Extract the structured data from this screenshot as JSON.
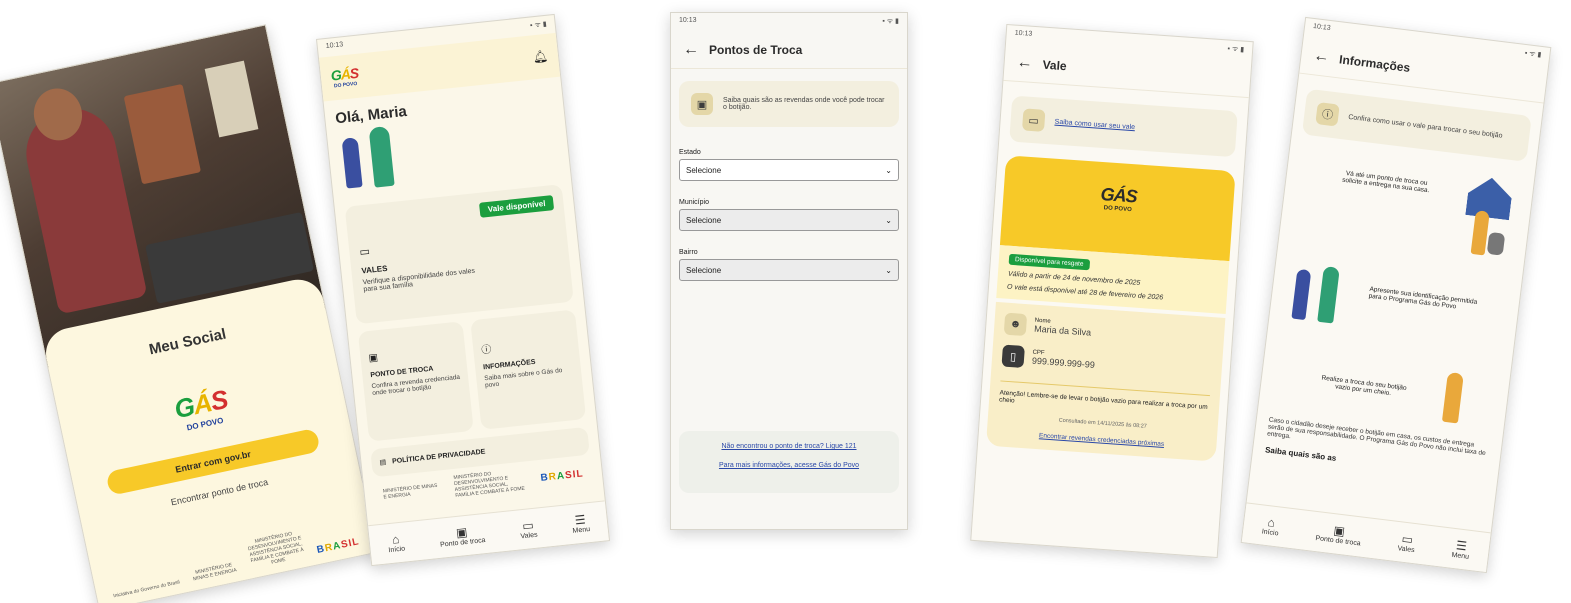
{
  "screen1": {
    "title": "Meu Social",
    "logo": {
      "g": "G",
      "a": "Á",
      "s": "S",
      "sub": "DO POVO"
    },
    "login_button": "Entrar com gov.br",
    "find_link": "Encontrar ponto de troca",
    "footer_initiative": "Iniciativa do Governo do Brasil",
    "ministry_1": "MINISTÉRIO DE MINAS E ENERGIA",
    "ministry_2": "MINISTÉRIO DO DESENVOLVIMENTO E ASSISTÊNCIA SOCIAL, FAMÍLIA E COMBATE À FOME",
    "brasil": [
      "B",
      "R",
      "A",
      "SIL"
    ]
  },
  "screen2": {
    "status_time": "10:13",
    "greeting": "Olá, Maria",
    "vales_badge": "Vale disponível",
    "vales_title": "VALES",
    "vales_desc": "Verifique a disponibilidade dos vales para sua família",
    "ponto_title": "PONTO DE TROCA",
    "ponto_desc": "Confira a revenda credenciada onde trocar o botijão",
    "info_title": "INFORMAÇÕES",
    "info_desc": "Saiba mais sobre o Gás do povo",
    "privacy": "POLÍTICA DE PRIVACIDADE",
    "ministry_1": "MINISTÉRIO DE MINAS E ENERGIA",
    "ministry_2": "MINISTÉRIO DO DESENVOLVIMENTO E ASSISTÊNCIA SOCIAL, FAMÍLIA E COMBATE À FOME",
    "nav": [
      "Início",
      "Ponto de troca",
      "Vales",
      "Menu"
    ]
  },
  "screen3": {
    "status_time": "10:13",
    "title": "Pontos de Troca",
    "info": "Saiba quais são as revendas onde você pode trocar o botijão.",
    "estado_label": "Estado",
    "municipio_label": "Município",
    "bairro_label": "Bairro",
    "select_placeholder": "Selecione",
    "help_link": "Não encontrou o ponto de troca? Ligue 121",
    "more_link": "Para mais informações, acesse Gás do Povo"
  },
  "screen4": {
    "status_time": "10:13",
    "title": "Vale",
    "how_link": "Saiba como usar seu vale",
    "status_badge": "Disponível para resgate",
    "valid_from": "Válido a partir de 24 de novembro de 2025",
    "valid_until": "O vale está disponível até 28 de fevereiro de 2026",
    "name_label": "Nome",
    "name_value": "Maria da Silva",
    "cpf_label": "CPF",
    "cpf_value": "999.999.999-99",
    "attention": "Atenção! Lembre-se de levar o botijão vazio para realizar a troca por um cheio",
    "consulted": "Consultado em 14/11/2025 às 08:27",
    "nearby_link": "Encontrar revendas credenciadas próximas"
  },
  "screen5": {
    "status_time": "10:13",
    "title": "Informações",
    "info": "Confira como usar o vale para trocar o seu botijão",
    "step1": "Vá até um ponto de troca ou solicite a entrega na sua casa.",
    "step2": "Apresente sua identificação permitida para o Programa Gás do Povo",
    "step3": "Realize a troca do seu botijão vazio por um cheio.",
    "note": "Caso o cidadão deseje receber o botijão em casa, os custos de entrega serão de sua responsabilidade. O Programa Gás do Povo não inclui taxa de entrega.",
    "more_title": "Saiba quais são as",
    "nav": [
      "Início",
      "Ponto de troca",
      "Vales",
      "Menu"
    ]
  },
  "colors": {
    "accent_yellow": "#f7c928",
    "green": "#1b9e3e",
    "cream": "#f3efdf"
  }
}
